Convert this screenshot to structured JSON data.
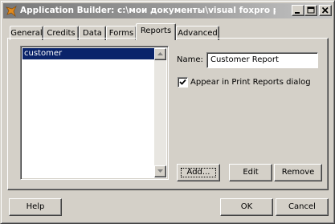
{
  "window": {
    "title": "Application Builder: c:\\мои документы\\visual foxpro projects\\bo...",
    "controls": {
      "minimize": "minimize",
      "maximize": "maximize",
      "close": "close"
    }
  },
  "tabs": [
    {
      "label": "General",
      "active": false
    },
    {
      "label": "Credits",
      "active": false
    },
    {
      "label": "Data",
      "active": false
    },
    {
      "label": "Forms",
      "active": false
    },
    {
      "label": "Reports",
      "active": true
    },
    {
      "label": "Advanced",
      "active": false
    }
  ],
  "reports": {
    "list_items": [
      "customer"
    ],
    "selected_index": 0,
    "name_label": "Name:",
    "name_value": "Customer Report",
    "print_label": "Appear in Print Reports dialog",
    "print_checked": true,
    "add_label": "Add...",
    "edit_label": "Edit",
    "remove_label": "Remove"
  },
  "footer": {
    "help_label": "Help",
    "ok_label": "OK",
    "cancel_label": "Cancel"
  },
  "colors": {
    "face": "#d4d0c8",
    "selection": "#0a246a",
    "title_gradient_start": "#7a7a7a",
    "title_gradient_end": "#c4c4c4"
  }
}
